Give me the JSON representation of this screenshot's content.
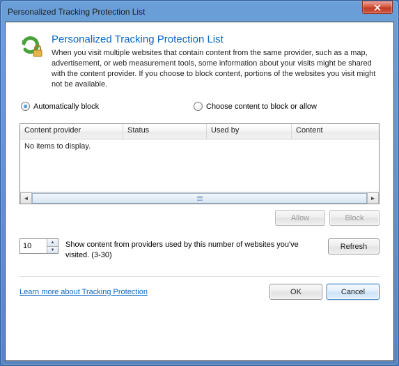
{
  "window": {
    "title": "Personalized Tracking Protection List"
  },
  "header": {
    "heading": "Personalized Tracking Protection List",
    "description": "When you visit multiple websites that contain content from the same provider, such as a map, advertisement, or web measurement tools, some information about your visits might be shared with the content provider.  If you choose to block content, portions of the websites you visit might not be available."
  },
  "radios": {
    "auto_label": "Automatically block",
    "choose_label": "Choose content to block or allow",
    "selected": "auto"
  },
  "table": {
    "columns": {
      "provider": "Content provider",
      "status": "Status",
      "used_by": "Used by",
      "content": "Content"
    },
    "placeholder": "No items to display."
  },
  "buttons": {
    "allow": "Allow",
    "block": "Block",
    "refresh": "Refresh",
    "ok": "OK",
    "cancel": "Cancel"
  },
  "threshold": {
    "value": "10",
    "text": "Show content from providers used by this number of websites you've visited. (3-30)"
  },
  "footer": {
    "link": "Learn more about Tracking Protection"
  }
}
